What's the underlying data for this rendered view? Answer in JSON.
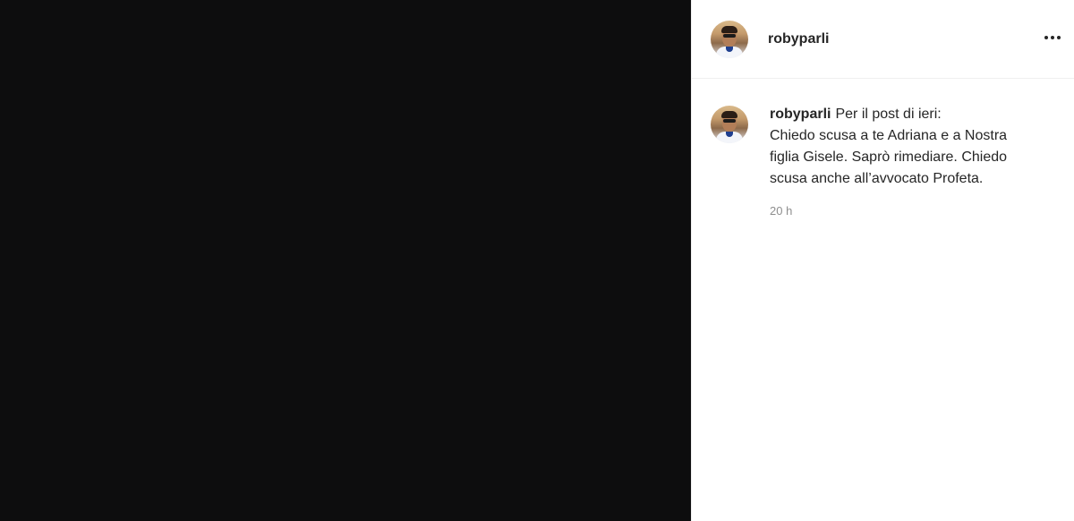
{
  "post": {
    "username": "robyparli",
    "more_icon": "more-horizontal-icon",
    "caption": {
      "author": "robyparli",
      "lines": [
        "Per il post di ieri:",
        "Chiedo scusa a te Adriana e a Nostra",
        "figlia Gisele. Saprò rimediare. Chiedo",
        "scusa anche all’avvocato Profeta."
      ],
      "timestamp": "20 h"
    },
    "colors": {
      "media_background": "#0d0d0e",
      "text": "#262626",
      "muted": "#8e8e8e"
    }
  }
}
